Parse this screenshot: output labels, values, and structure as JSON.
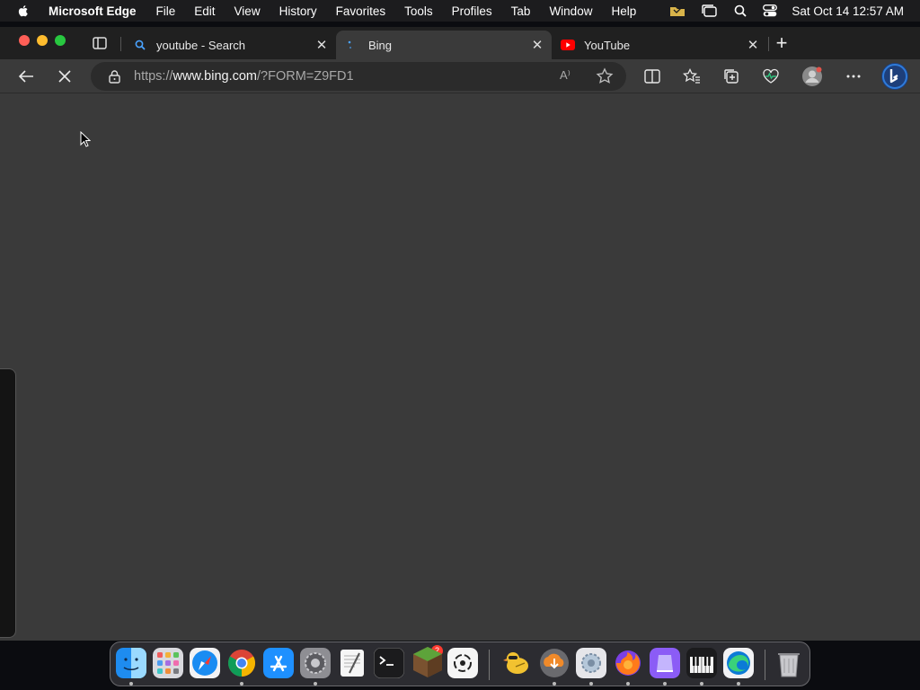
{
  "menubar": {
    "app_name": "Microsoft Edge",
    "items": [
      "File",
      "Edit",
      "View",
      "History",
      "Favorites",
      "Tools",
      "Profiles",
      "Tab",
      "Window",
      "Help"
    ],
    "clock": "Sat Oct 14  12:57 AM"
  },
  "tabs": [
    {
      "title": "youtube - Search",
      "icon": "search-icon"
    },
    {
      "title": "Bing",
      "icon": "loading-spinner-icon",
      "active": true
    },
    {
      "title": "YouTube",
      "icon": "youtube-icon"
    }
  ],
  "toolbar": {
    "url_prefix": "https://",
    "url_host": "www.bing.com",
    "url_path": "/?FORM=Z9FD1",
    "read_aloud_label": "A⁾"
  },
  "dock": {
    "apps": [
      "finder-icon",
      "launchpad-icon",
      "safari-icon",
      "chrome-icon",
      "app-store-icon",
      "system-settings-icon",
      "textedit-icon",
      "terminal-icon",
      "minecraft-icon",
      "chatgpt-icon",
      "cyberduck-icon",
      "downloader-icon",
      "settings-icon",
      "firefox-icon",
      "app-icon",
      "piano-icon",
      "edge-icon",
      "trash-icon"
    ],
    "settings_badge": "2"
  },
  "colors": {
    "accent": "#1a73e8",
    "tab_active": "#3a3a3a",
    "page_bg": "#3a3a3a"
  }
}
